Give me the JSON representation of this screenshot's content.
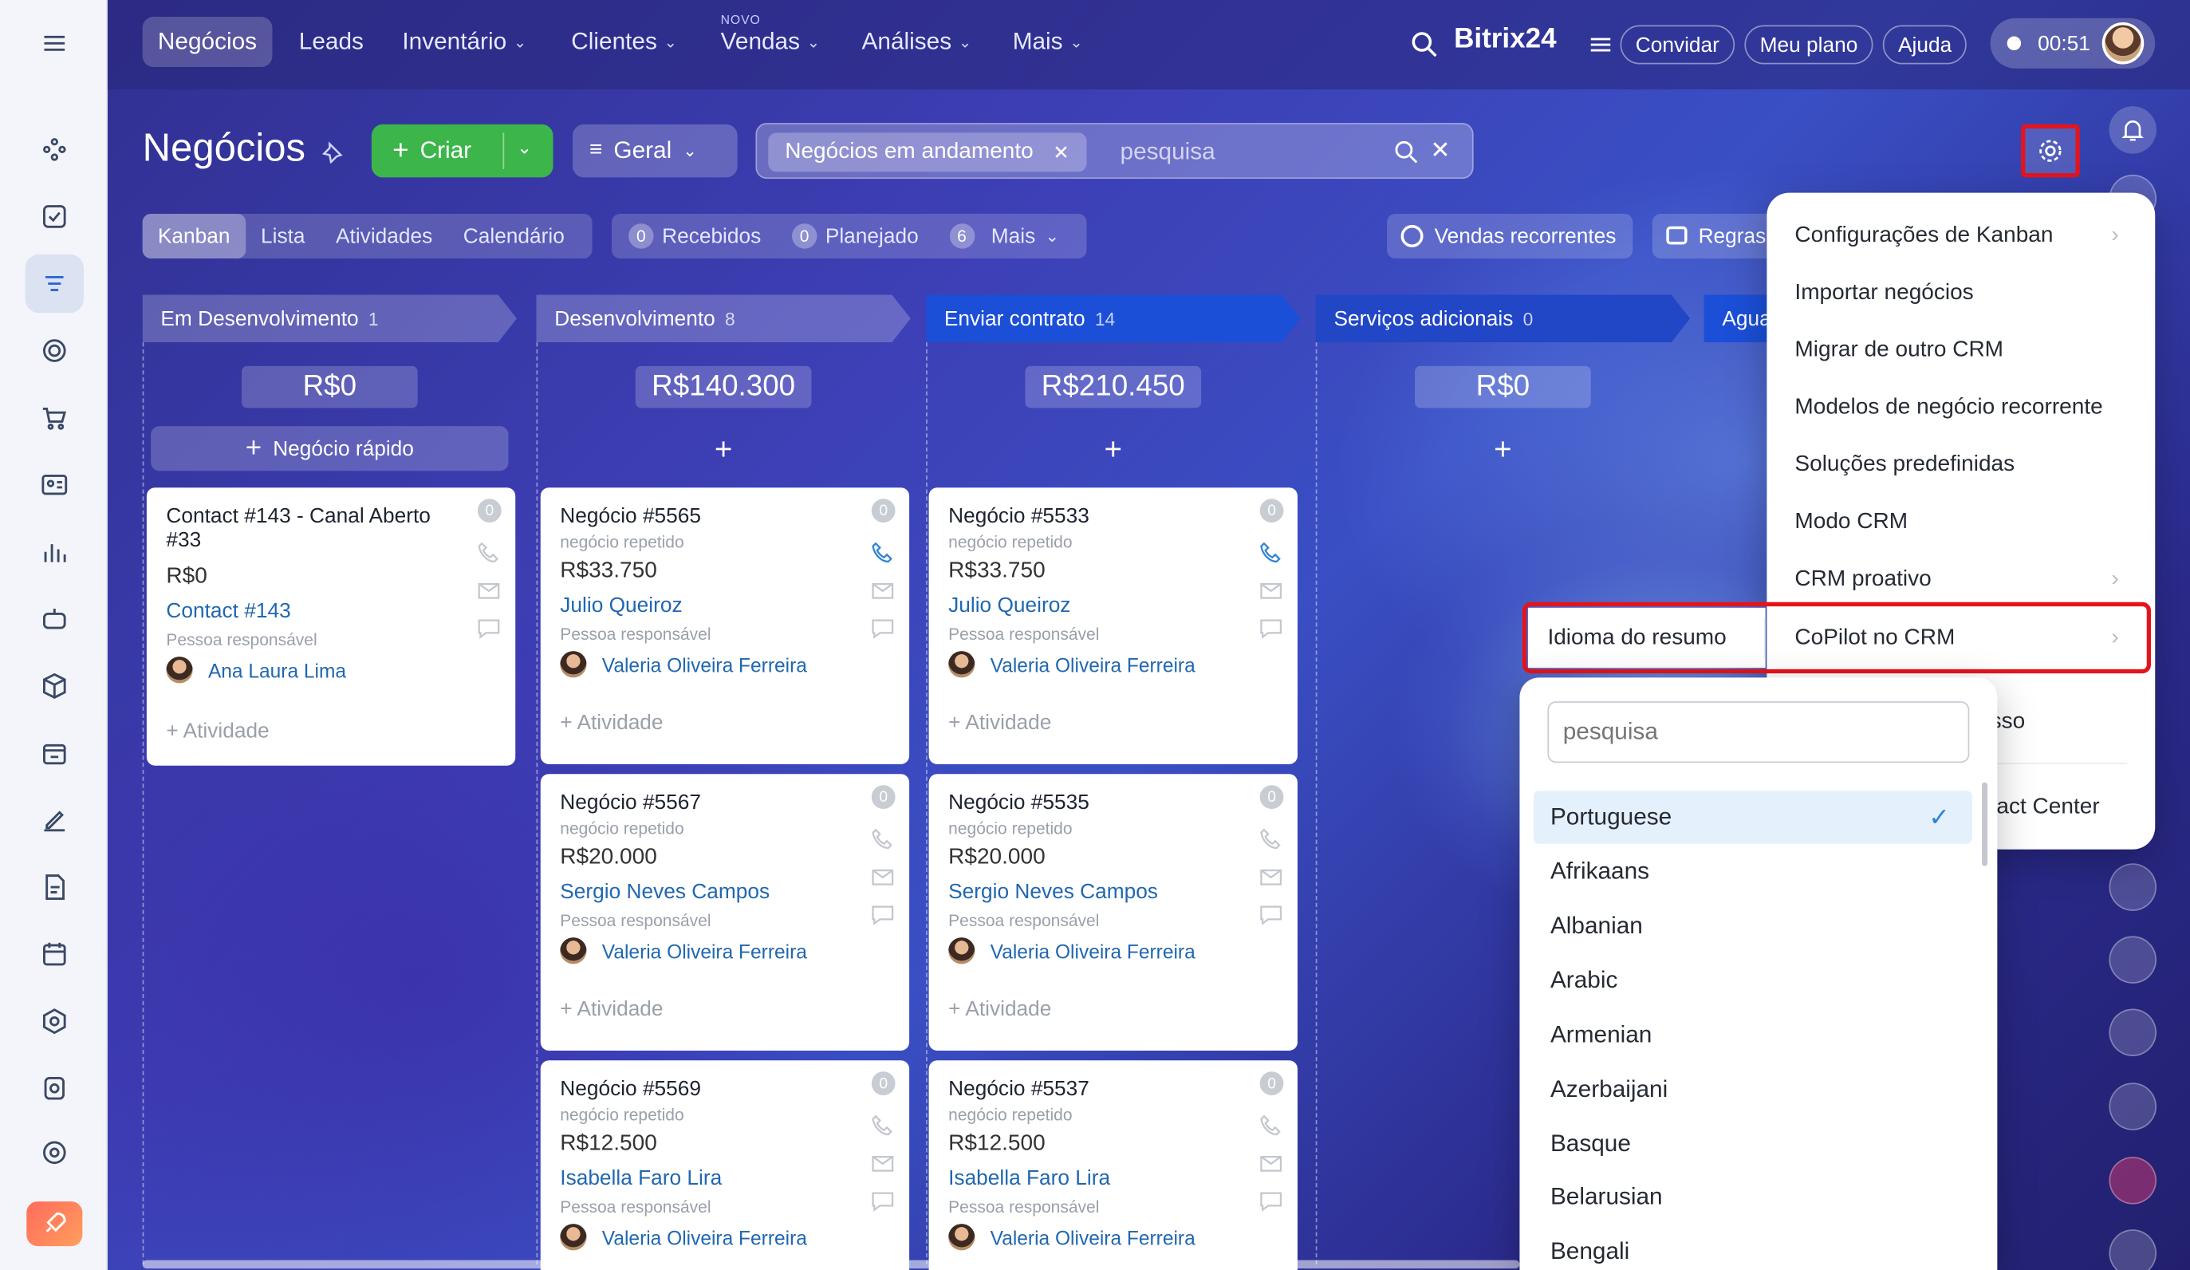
{
  "nav": {
    "items": [
      "Negócios",
      "Leads",
      "Inventário",
      "Clientes",
      "Vendas",
      "Análises",
      "Mais"
    ],
    "novo_badge": "NOVO",
    "brand": "Bitrix24",
    "invite": "Convidar",
    "plan": "Meu plano",
    "help": "Ajuda",
    "timer": "00:51"
  },
  "header": {
    "title": "Negócios",
    "create": "Criar",
    "general": "Geral",
    "filter_tag": "Negócios em andamento",
    "search_placeholder": "pesquisa"
  },
  "views": [
    "Kanban",
    "Lista",
    "Atividades",
    "Calendário"
  ],
  "counters": [
    {
      "num": "0",
      "label": "Recebidos"
    },
    {
      "num": "0",
      "label": "Planejado"
    },
    {
      "num": "6",
      "label": "Mais"
    }
  ],
  "toolbar": {
    "recurring": "Vendas recorrentes",
    "rules": "Regras"
  },
  "columns": [
    {
      "name": "Em Desenvolvimento",
      "count": "1",
      "sum": "R$0",
      "quick": "Negócio rápido"
    },
    {
      "name": "Desenvolvimento",
      "count": "8",
      "sum": "R$140.300"
    },
    {
      "name": "Enviar contrato",
      "count": "14",
      "sum": "R$210.450"
    },
    {
      "name": "Serviços adicionais",
      "count": "0",
      "sum": "R$0"
    },
    {
      "name": "Agua",
      "count": ""
    }
  ],
  "cards": {
    "c0": {
      "title": "Contact #143 - Canal Aberto #33",
      "price": "R$0",
      "link": "Contact #143",
      "resp": "Pessoa responsável",
      "person": "Ana Laura Lima",
      "act": "+ Atividade",
      "badge": "0"
    },
    "c1": {
      "title": "Negócio #5565",
      "sub": "negócio repetido",
      "price": "R$33.750",
      "link": "Julio Queiroz",
      "resp": "Pessoa responsável",
      "person": "Valeria Oliveira Ferreira",
      "act": "+ Atividade",
      "badge": "0"
    },
    "c2": {
      "title": "Negócio #5567",
      "sub": "negócio repetido",
      "price": "R$20.000",
      "link": "Sergio Neves Campos",
      "resp": "Pessoa responsável",
      "person": "Valeria Oliveira Ferreira",
      "act": "+ Atividade",
      "badge": "0"
    },
    "c3": {
      "title": "Negócio #5569",
      "sub": "negócio repetido",
      "price": "R$12.500",
      "link": "Isabella Faro Lira",
      "resp": "Pessoa responsável",
      "person": "Valeria Oliveira Ferreira",
      "badge": "0"
    },
    "c4": {
      "title": "Negócio #5533",
      "sub": "negócio repetido",
      "price": "R$33.750",
      "link": "Julio Queiroz",
      "resp": "Pessoa responsável",
      "person": "Valeria Oliveira Ferreira",
      "act": "+ Atividade",
      "badge": "0"
    },
    "c5": {
      "title": "Negócio #5535",
      "sub": "negócio repetido",
      "price": "R$20.000",
      "link": "Sergio Neves Campos",
      "resp": "Pessoa responsável",
      "person": "Valeria Oliveira Ferreira",
      "act": "+ Atividade",
      "badge": "0"
    },
    "c6": {
      "title": "Negócio #5537",
      "sub": "negócio repetido",
      "price": "R$12.500",
      "link": "Isabella Faro Lira",
      "resp": "Pessoa responsável",
      "person": "Valeria Oliveira Ferreira",
      "badge": "0"
    }
  },
  "settings_menu": [
    "Configurações de Kanban",
    "Importar negócios",
    "Migrar de outro CRM",
    "Modelos de negócio recorrente",
    "Soluções predefinidas",
    "Modo CRM",
    "CRM proativo",
    "CoPilot no CRM"
  ],
  "settings_menu_partial": [
    "sso",
    "tact Center"
  ],
  "submenu_title": "Idioma do resumo",
  "languages": {
    "search_placeholder": "pesquisa",
    "selected": "Portuguese",
    "items": [
      "Portuguese",
      "Afrikaans",
      "Albanian",
      "Arabic",
      "Armenian",
      "Azerbaijani",
      "Basque",
      "Belarusian",
      "Bengali"
    ]
  },
  "colors": {
    "accent": "#2f66d6",
    "create_green": "#3cb54a",
    "highlight_red": "#e5141b",
    "stage_blue": "#1b4fd8"
  }
}
